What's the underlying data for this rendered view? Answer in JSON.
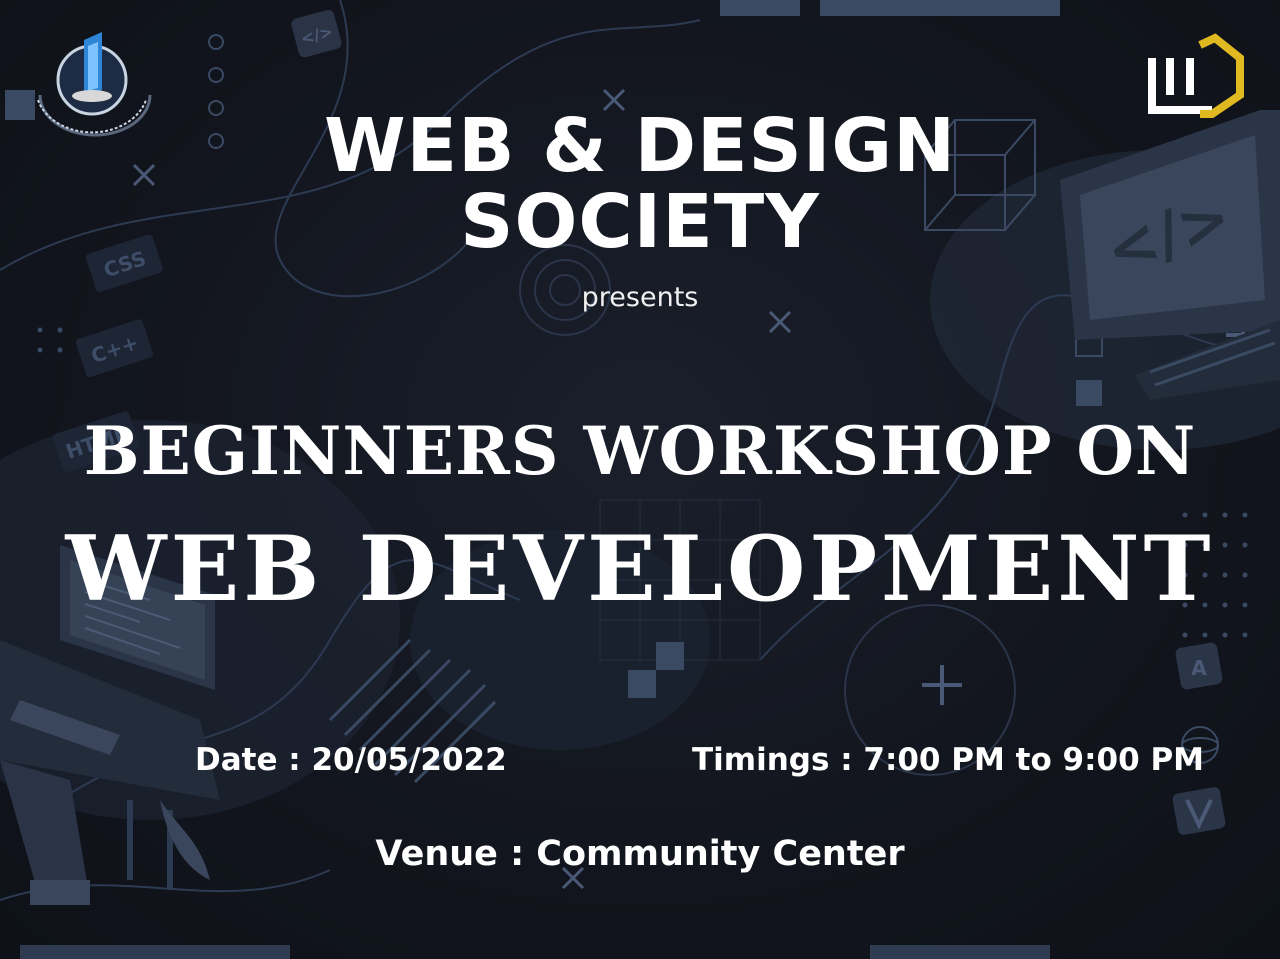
{
  "society": {
    "title_line1": "WEB & DESIGN",
    "title_line2": "SOCIETY",
    "presents": "presents"
  },
  "event": {
    "headline_1": "BEGINNERS WORKSHOP ON",
    "headline_2": "WEB DEVELOPMENT",
    "date": "Date : 20/05/2022",
    "timings": "Timings : 7:00 PM to 9:00 PM",
    "venue": "Venue : Community Center"
  },
  "decor": {
    "css_tag": "CSS",
    "cpp_tag": "C++",
    "html_tag": "HTML",
    "code_symbol": "</>"
  },
  "colors": {
    "background": "#12151d",
    "text": "#ffffff",
    "decor": "#3a4a63",
    "logo_gold": "#e0b820"
  }
}
